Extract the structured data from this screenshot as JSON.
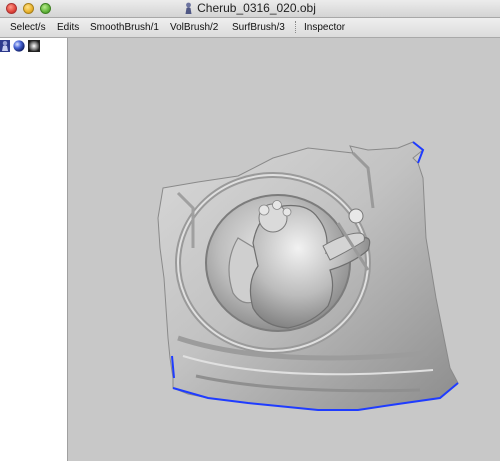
{
  "window": {
    "title": "Cherub_0316_020.obj"
  },
  "toolbar": {
    "items": [
      "Select/s",
      "Edits",
      "SmoothBrush/1",
      "VolBrush/2",
      "SurfBrush/3",
      "Inspector"
    ]
  },
  "left_panel": {
    "icons": [
      "figure-icon",
      "sphere-icon",
      "texture-icon"
    ]
  },
  "viewport": {
    "model": "cherub relief mesh",
    "background_color": "#c8c8c8",
    "boundary_color": "#1f3cff"
  }
}
